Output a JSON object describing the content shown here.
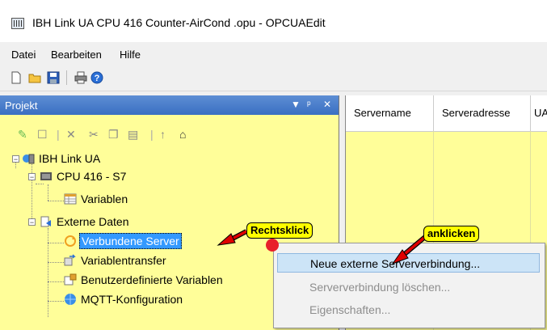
{
  "window": {
    "title": "IBH Link UA CPU 416 Counter-AirCond .opu - OPCUAEdit"
  },
  "menu": {
    "items": [
      "Datei",
      "Bearbeiten",
      "Hilfe"
    ]
  },
  "toolbar": {
    "icons": [
      "new-icon",
      "open-folder-icon",
      "save-icon",
      "print-icon",
      "help-icon"
    ]
  },
  "panel": {
    "title": "Projekt",
    "controls": [
      "▼",
      "ᵖ",
      "✕"
    ]
  },
  "tree": {
    "root": "IBH Link UA",
    "cpu": "CPU 416 - S7",
    "variables": "Variablen",
    "external": "Externe Daten",
    "connected": "Verbundene Server",
    "transfer": "Variablentransfer",
    "userdefined": "Benutzerdefinierte Variablen",
    "mqtt": "MQTT-Konfiguration"
  },
  "grid": {
    "columns": [
      "Servername",
      "Serveradresse",
      "UA"
    ]
  },
  "context_menu": {
    "items": [
      {
        "label": "Neue externe Serververbindung...",
        "state": "hover"
      },
      {
        "label": "Serververbindung löschen...",
        "state": "disabled"
      },
      {
        "label": "Eigenschaften...",
        "state": "disabled"
      }
    ]
  },
  "callouts": {
    "right_click": "Rechtsklick",
    "click": "anklicken"
  },
  "colors": {
    "panel_bg": "#fffe99",
    "header": "#3a6fc2",
    "selection": "#3399ff",
    "callout": "#ffff00",
    "arrow": "#e00000"
  }
}
